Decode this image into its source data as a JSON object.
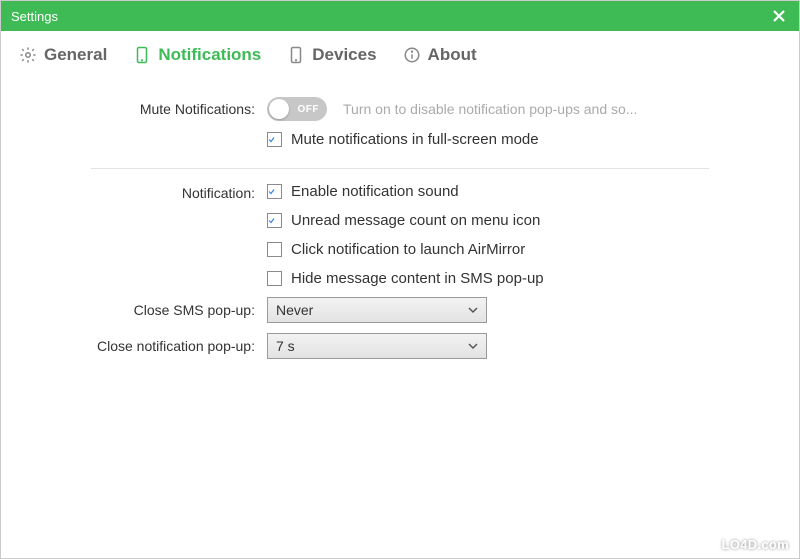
{
  "window": {
    "title": "Settings"
  },
  "tabs": {
    "general": "General",
    "notifications": "Notifications",
    "devices": "Devices",
    "about": "About",
    "active": "notifications"
  },
  "mute": {
    "label": "Mute Notifications:",
    "state": "OFF",
    "on": false,
    "hint": "Turn on to disable notification pop-ups and so..."
  },
  "fullscreen": {
    "label": "Mute notifications in full-screen mode",
    "checked": true
  },
  "section": {
    "label": "Notification:"
  },
  "opts": {
    "sound": {
      "label": "Enable notification sound",
      "checked": true
    },
    "unread": {
      "label": "Unread message count on menu icon",
      "checked": true
    },
    "airm": {
      "label": "Click notification to launch AirMirror",
      "checked": false
    },
    "hide": {
      "label": "Hide message content in SMS pop-up",
      "checked": false
    }
  },
  "sms": {
    "label": "Close SMS pop-up:",
    "value": "Never"
  },
  "notif": {
    "label": "Close notification pop-up:",
    "value": "7 s"
  },
  "watermark": "LO4D.com",
  "colors": {
    "accent": "#3fbb56",
    "check": "#2f7fe6"
  }
}
